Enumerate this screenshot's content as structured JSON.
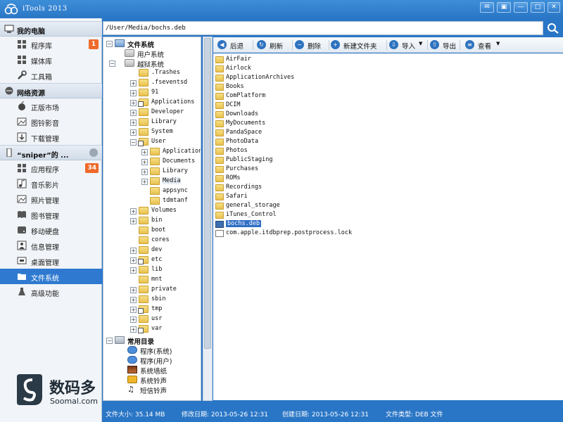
{
  "window": {
    "title": "iTools 2013",
    "buttons": {
      "feedback": "✉",
      "skin": "▣",
      "minimize": "—",
      "maximize": "□",
      "close": "✕"
    }
  },
  "sidebar": {
    "groups": [
      {
        "label": "我的电脑",
        "items": [
          {
            "label": "程序库",
            "badge": "1"
          },
          {
            "label": "媒体库"
          },
          {
            "label": "工具箱"
          }
        ]
      },
      {
        "label": "网络资源",
        "items": [
          {
            "label": "正版市场"
          },
          {
            "label": "图铃影音"
          },
          {
            "label": "下载管理"
          }
        ]
      },
      {
        "label": "“sniper”的 ...",
        "items": [
          {
            "label": "应用程序",
            "badge": "34"
          },
          {
            "label": "音乐影片"
          },
          {
            "label": "照片管理"
          },
          {
            "label": "图书管理"
          },
          {
            "label": "移动硬盘"
          },
          {
            "label": "信息管理"
          },
          {
            "label": "桌面管理"
          },
          {
            "label": "文件系统",
            "active": true
          },
          {
            "label": "高级功能"
          }
        ]
      }
    ],
    "brand": {
      "cn": "数码多",
      "en": "Soomal.com"
    }
  },
  "path": {
    "value": "/User/Media/bochs.deb"
  },
  "tree": {
    "root": "文件系统",
    "user_fs": "用户系统",
    "jb_fs": "越狱系统",
    "level1": [
      ".Trashes",
      ".fseventsd",
      "91",
      "Applications",
      "Developer",
      "Library",
      "System",
      "User"
    ],
    "user_children": [
      "Applications",
      "Documents",
      "Library",
      "Media",
      "appsync",
      "tdmtanf"
    ],
    "level1b": [
      "Volumes",
      "bin",
      "boot",
      "cores",
      "dev",
      "etc",
      "lib",
      "mnt",
      "private",
      "sbin",
      "tmp",
      "usr",
      "var"
    ],
    "common": "常用目录",
    "common_items": [
      "程序(系统)",
      "程序(用户)",
      "系统墙纸",
      "系统铃声",
      "短信铃声"
    ]
  },
  "toolbar": {
    "back": "后退",
    "refresh": "刷新",
    "delete": "删除",
    "new_folder": "新建文件夹",
    "import": "导入",
    "export": "导出",
    "view": "查看"
  },
  "files": [
    {
      "name": "AirFair",
      "type": "folder"
    },
    {
      "name": "Airlock",
      "type": "folder"
    },
    {
      "name": "ApplicationArchives",
      "type": "folder"
    },
    {
      "name": "Books",
      "type": "folder"
    },
    {
      "name": "ComPlatform",
      "type": "folder"
    },
    {
      "name": "DCIM",
      "type": "folder"
    },
    {
      "name": "Downloads",
      "type": "folder"
    },
    {
      "name": "MyDocuments",
      "type": "folder"
    },
    {
      "name": "PandaSpace",
      "type": "folder"
    },
    {
      "name": "PhotoData",
      "type": "folder"
    },
    {
      "name": "Photos",
      "type": "folder"
    },
    {
      "name": "PublicStaging",
      "type": "folder"
    },
    {
      "name": "Purchases",
      "type": "folder"
    },
    {
      "name": "ROMs",
      "type": "folder"
    },
    {
      "name": "Recordings",
      "type": "folder"
    },
    {
      "name": "Safari",
      "type": "folder"
    },
    {
      "name": "general_storage",
      "type": "folder"
    },
    {
      "name": "iTunes_Control",
      "type": "folder"
    },
    {
      "name": "bochs.deb",
      "type": "deb",
      "selected": true
    },
    {
      "name": "com.apple.itdbprep.postprocess.lock",
      "type": "file"
    }
  ],
  "status": {
    "size": "文件大小: 35.14 MB",
    "modified": "修改日期: 2013-05-26 12:31",
    "created": "创建日期: 2013-05-26 12:31",
    "type": "文件类型: DEB 文件"
  }
}
